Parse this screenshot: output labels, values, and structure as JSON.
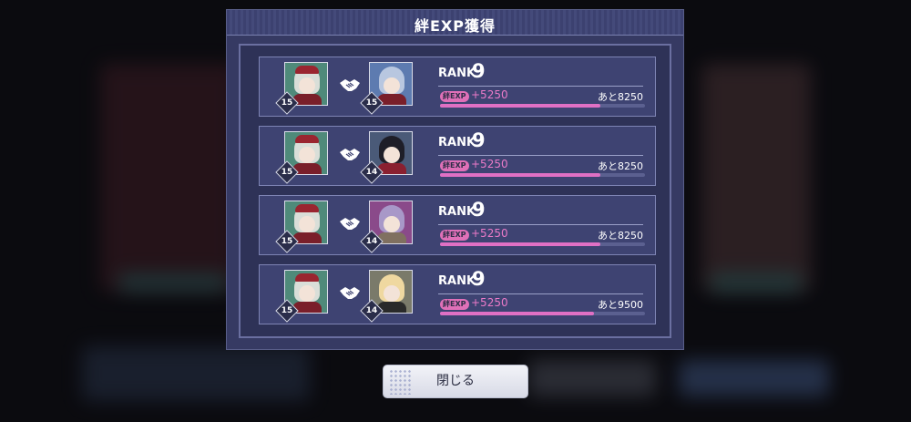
{
  "dialog": {
    "title": "絆EXP獲得",
    "close_label": "閉じる"
  },
  "rows": [
    {
      "left_level": "15",
      "right_level": "15",
      "rank_label": "RANK",
      "rank": "9",
      "exp_badge": "絆EXP",
      "exp_gain": "+5250",
      "remaining": "あと8250",
      "progress_percent": 78
    },
    {
      "left_level": "15",
      "right_level": "14",
      "rank_label": "RANK",
      "rank": "9",
      "exp_badge": "絆EXP",
      "exp_gain": "+5250",
      "remaining": "あと8250",
      "progress_percent": 78
    },
    {
      "left_level": "15",
      "right_level": "14",
      "rank_label": "RANK",
      "rank": "9",
      "exp_badge": "絆EXP",
      "exp_gain": "+5250",
      "remaining": "あと8250",
      "progress_percent": 78
    },
    {
      "left_level": "15",
      "right_level": "14",
      "rank_label": "RANK",
      "rank": "9",
      "exp_badge": "絆EXP",
      "exp_gain": "+5250",
      "remaining": "あと9500",
      "progress_percent": 75
    }
  ],
  "colors": {
    "accent": "#e070c4",
    "panel": "#363a63",
    "row": "#3e4372"
  }
}
